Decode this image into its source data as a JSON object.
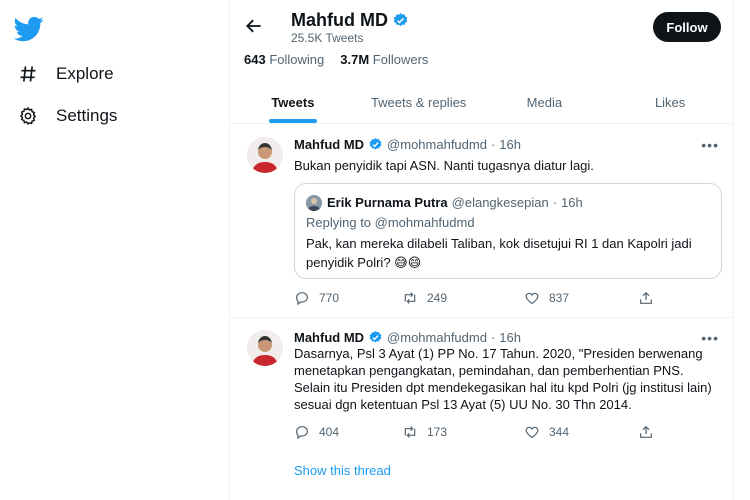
{
  "sidebar": {
    "logo": "twitter-bird-logo",
    "items": [
      {
        "label": "Explore",
        "icon": "hashtag-icon"
      },
      {
        "label": "Settings",
        "icon": "gear-icon"
      }
    ]
  },
  "profile": {
    "name": "Mahfud MD",
    "tweet_count": "25.5K Tweets",
    "follow_label": "Follow",
    "following_count": "643",
    "following_label": "Following",
    "followers_count": "3.7M",
    "followers_label": "Followers"
  },
  "tabs": [
    {
      "label": "Tweets",
      "active": true
    },
    {
      "label": "Tweets & replies",
      "active": false
    },
    {
      "label": "Media",
      "active": false
    },
    {
      "label": "Likes",
      "active": false
    }
  ],
  "tweets": [
    {
      "name": "Mahfud MD",
      "handle": "@mohmahfudmd",
      "sep": "·",
      "time": "16h",
      "text": "Bukan penyidik tapi ASN. Nanti tugasnya diatur lagi.",
      "quote": {
        "name": "Erik Purnama Putra",
        "handle": "@elangkesepian",
        "sep": "·",
        "time": "16h",
        "replying": "Replying to @mohmahfudmd",
        "text": "Pak, kan mereka dilabeli Taliban, kok disetujui RI 1 dan Kapolri jadi penyidik Polri? 😅😄"
      },
      "replies": "770",
      "retweets": "249",
      "likes": "837"
    },
    {
      "name": "Mahfud MD",
      "handle": "@mohmahfudmd",
      "sep": "·",
      "time": "16h",
      "text": "Dasarnya, Psl 3 Ayat (1) PP No. 17 Tahun. 2020, \"Presiden berwenang menetapkan pengangkatan, pemindahan, dan pemberhentian PNS. Selain itu Presiden dpt mendekegasikan hal itu kpd Polri (jg institusi lain) sesuai dgn ketentuan Psl 13 Ayat (5) UU No. 30 Thn 2014.",
      "replies": "404",
      "retweets": "173",
      "likes": "344",
      "show_thread": "Show this thread"
    }
  ],
  "colors": {
    "accent": "#1d9bf0",
    "text_primary": "#0f1419",
    "text_secondary": "#536471",
    "border": "#eff3f4",
    "follow_button": "#0f1419"
  }
}
